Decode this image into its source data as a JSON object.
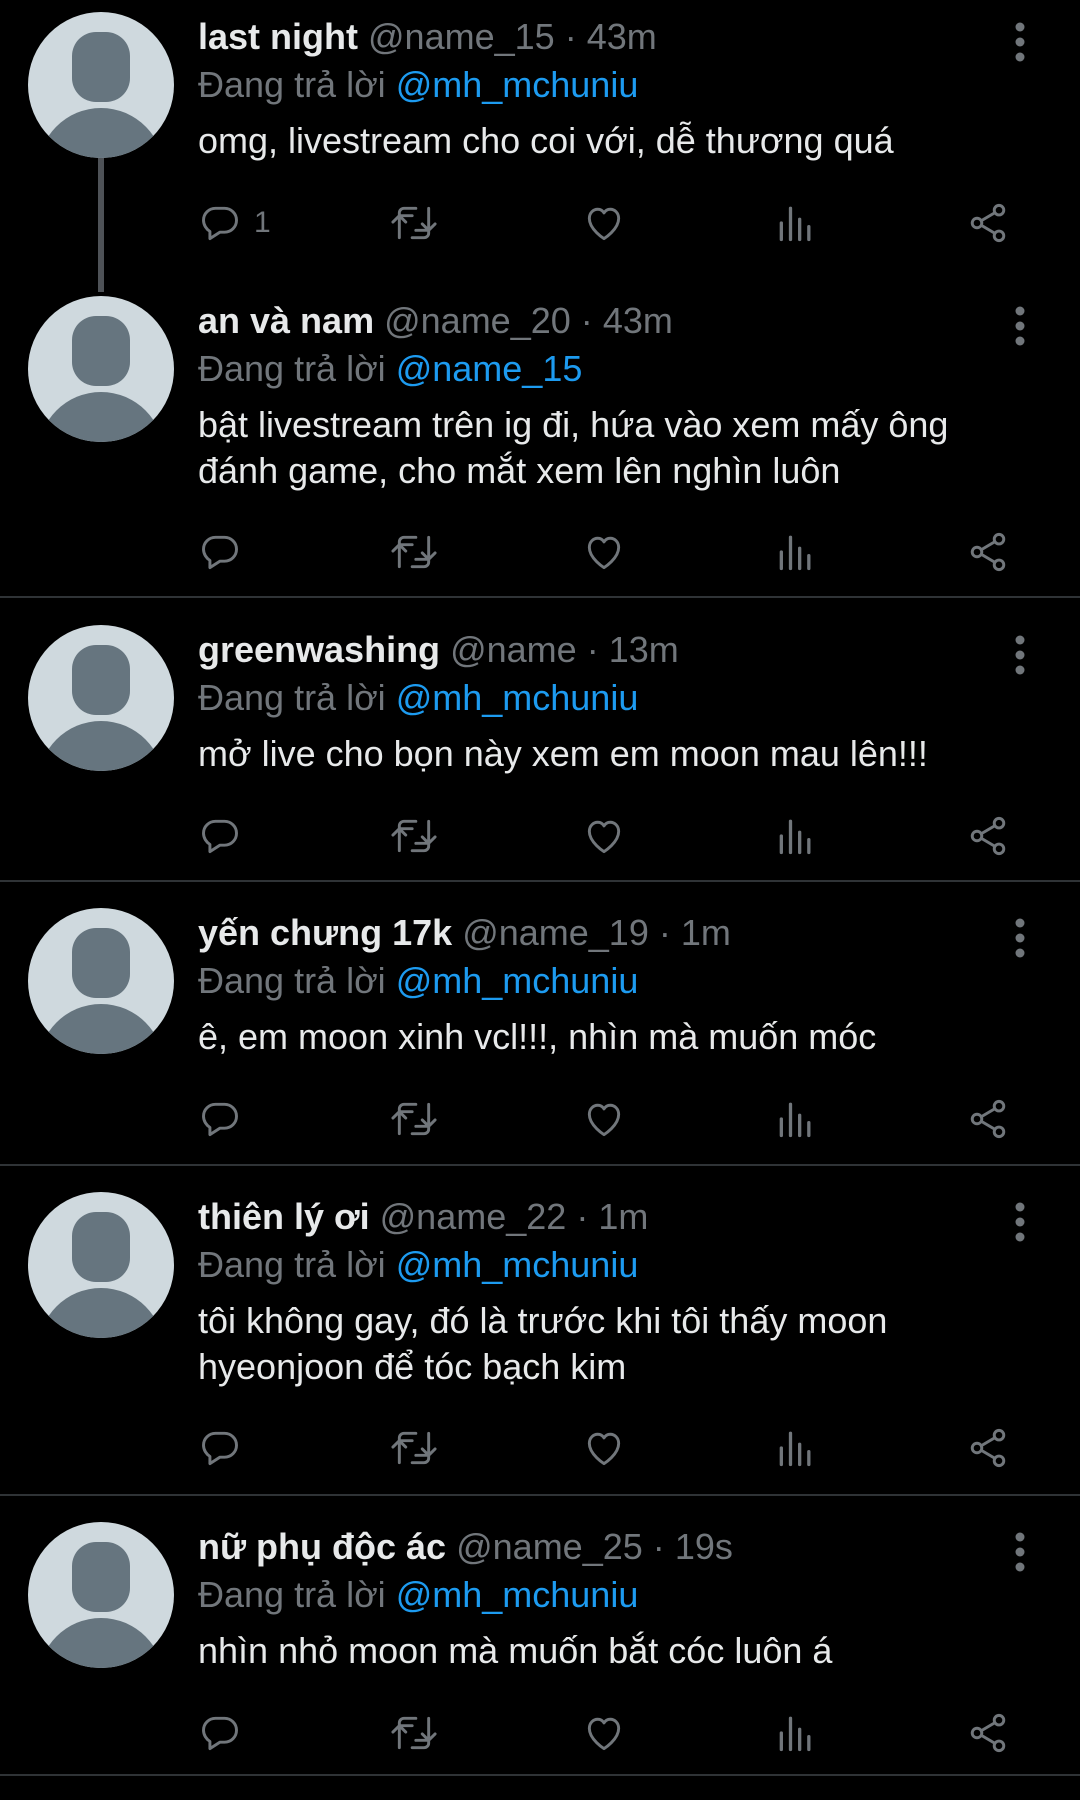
{
  "colors": {
    "background": "#000000",
    "text": "#e7e9ea",
    "secondary": "#71767b",
    "link": "#1d9bf0",
    "divider": "#2f3336",
    "avatar_bg": "#cfd9de",
    "avatar_fg": "#66757f"
  },
  "reply_prefix": "Đang trả lời",
  "action_icons": [
    "reply-icon",
    "retweet-icon",
    "like-icon",
    "views-icon",
    "share-icon"
  ],
  "tweets": [
    {
      "display_name": "last night",
      "handle": "@name_15",
      "separator": "·",
      "time": "43m",
      "reply_to": "@mh_mchuniu",
      "text": "omg, livestream cho coi với, dễ thương quá",
      "reply_count": "1"
    },
    {
      "display_name": "an và nam",
      "handle": "@name_20",
      "separator": "·",
      "time": "43m",
      "reply_to": "@name_15",
      "text": "bật livestream trên ig đi, hứa vào xem mấy ông đánh game, cho mắt xem lên nghìn luôn",
      "reply_count": ""
    },
    {
      "display_name": "greenwashing",
      "handle": "@name",
      "separator": "·",
      "time": "13m",
      "reply_to": "@mh_mchuniu",
      "text": "mở live cho bọn này xem em moon mau lên!!!",
      "reply_count": ""
    },
    {
      "display_name": "yến chưng 17k",
      "handle": "@name_19",
      "separator": "·",
      "time": "1m",
      "reply_to": "@mh_mchuniu",
      "text": "ê, em moon xinh vcl!!!, nhìn mà muốn móc",
      "reply_count": ""
    },
    {
      "display_name": "thiên lý ơi",
      "handle": "@name_22",
      "separator": "·",
      "time": "1m",
      "reply_to": "@mh_mchuniu",
      "text": "tôi không gay, đó là trước khi tôi thấy moon hyeonjoon để tóc bạch kim",
      "reply_count": ""
    },
    {
      "display_name": "nữ phụ độc ác",
      "handle": "@name_25",
      "separator": "·",
      "time": "19s",
      "reply_to": "@mh_mchuniu",
      "text": "nhìn nhỏ moon mà muốn bắt cóc luôn á",
      "reply_count": ""
    }
  ]
}
